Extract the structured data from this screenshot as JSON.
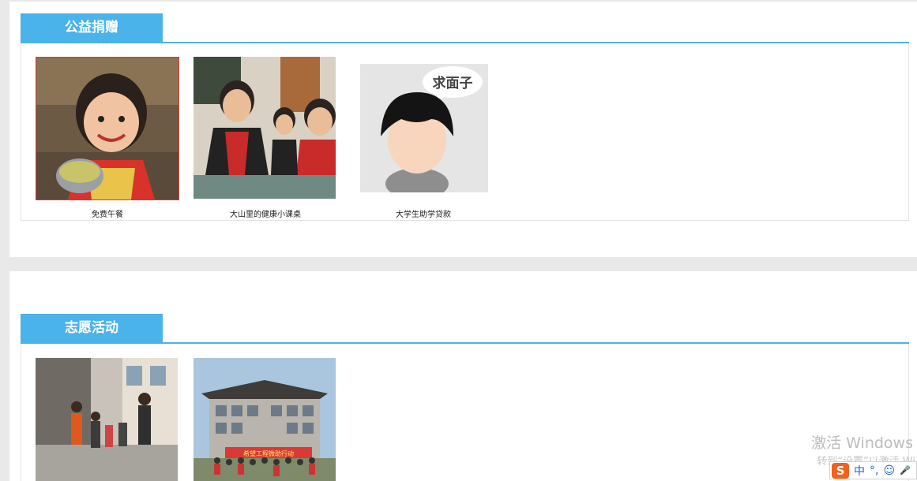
{
  "sections": [
    {
      "title": "公益捐赠",
      "items": [
        {
          "caption": "免费午餐",
          "image": "child-eating-lunch-photo"
        },
        {
          "caption": "大山里的健康小课桌",
          "image": "children-at-classroom-desks-photo"
        },
        {
          "caption": "大学生助学贷款",
          "image": "cartoon-avatar-求面子"
        }
      ]
    },
    {
      "title": "志愿活动",
      "items": [
        {
          "caption": "",
          "image": "volunteers-walking-street-photo"
        },
        {
          "caption": "",
          "image": "group-in-front-of-building-photo"
        }
      ]
    }
  ],
  "avatar_bubble_text": "求面子",
  "banner_text": "希望工程微助行动",
  "watermark": {
    "line1": "激活 Windows",
    "line2": "转到“设置”以激活 Wi"
  },
  "ime": {
    "logo": "S",
    "mode": "中",
    "punct": "°,",
    "emoji": "☺",
    "mic": "🎤"
  },
  "colors": {
    "accent": "#49b3ea",
    "accent_line": "#4db2e4",
    "page_bg": "#e9e9e9"
  }
}
